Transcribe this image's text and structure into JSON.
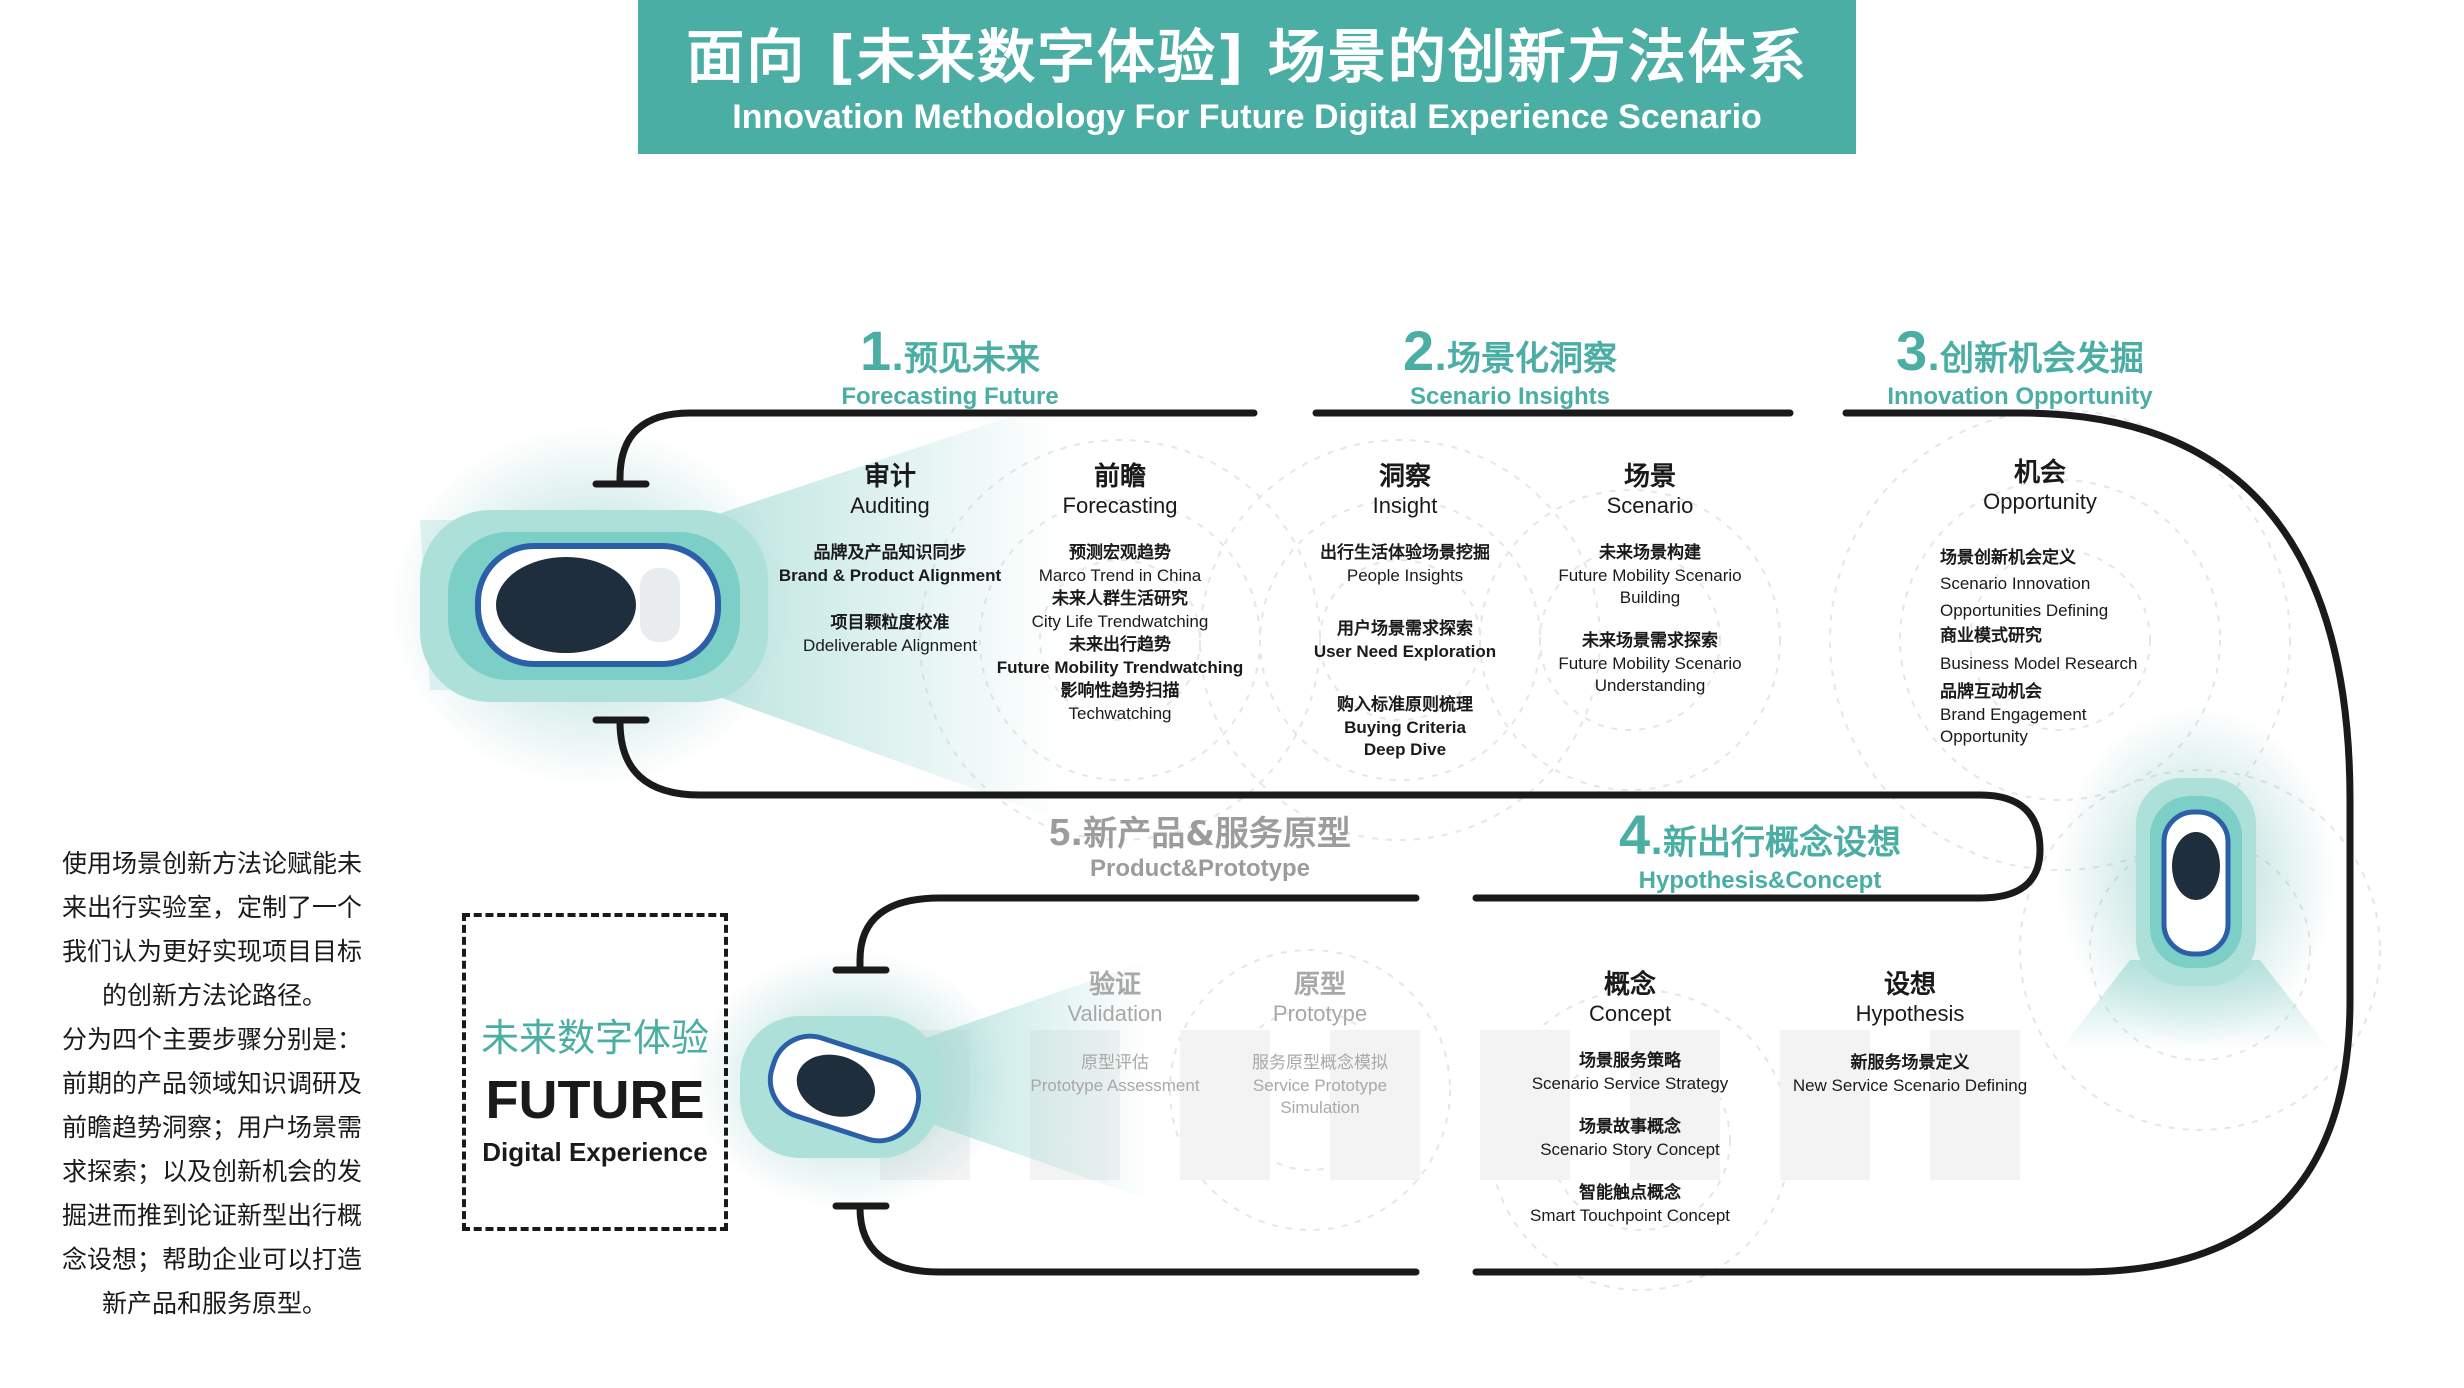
{
  "header": {
    "title_cn": "面向 [未来数字体验] 场景的创新方法体系",
    "title_en": "Innovation Methodology For Future Digital Experience Scenario"
  },
  "colors": {
    "accent": "#4aaea4",
    "track": "#1a1a1a",
    "muted": "#a8a8a8"
  },
  "steps": [
    {
      "num": "1",
      "cn": ".预见未来",
      "en": "Forecasting Future",
      "columns": [
        {
          "cn": "审计",
          "en": "Auditing",
          "items": [
            {
              "cn": "品牌及产品知识同步",
              "en": "Brand & Product Alignment"
            },
            {
              "cn": "项目颗粒度校准",
              "en": "Ddeliverable Alignment"
            }
          ]
        },
        {
          "cn": "前瞻",
          "en": "Forecasting",
          "items": [
            {
              "cn": "预测宏观趋势",
              "en": "Marco Trend in China"
            },
            {
              "cn": "未来人群生活研究",
              "en": "City Life Trendwatching"
            },
            {
              "cn": "未来出行趋势",
              "en": "Future Mobility Trendwatching"
            },
            {
              "cn": "影响性趋势扫描",
              "en": "Techwatching"
            }
          ]
        }
      ]
    },
    {
      "num": "2",
      "cn": ".场景化洞察",
      "en": "Scenario Insights",
      "columns": [
        {
          "cn": "洞察",
          "en": "Insight",
          "items": [
            {
              "cn": "出行生活体验场景挖掘",
              "en": "People Insights"
            },
            {
              "cn": "用户场景需求探索",
              "en": "User Need Exploration"
            },
            {
              "cn": "购入标准原则梳理",
              "en": "Buying Criteria Deep Dive"
            }
          ]
        },
        {
          "cn": "场景",
          "en": "Scenario",
          "items": [
            {
              "cn": "未来场景构建",
              "en": "Future Mobility Scenario Building"
            },
            {
              "cn": "未来场景需求探索",
              "en": "Future  Mobility Scenario Understanding"
            }
          ]
        }
      ]
    },
    {
      "num": "3",
      "cn": ".创新机会发掘",
      "en": "Innovation Opportunity",
      "columns": [
        {
          "cn": "机会",
          "en": "Opportunity",
          "items": [
            {
              "cn": "场景创新机会定义",
              "en": "Scenario Innovation Opportunities Defining"
            },
            {
              "cn": "商业模式研究",
              "en": "Business Model Research"
            },
            {
              "cn": "品牌互动机会",
              "en": "Brand Engagement Opportunity"
            }
          ]
        }
      ]
    },
    {
      "num": "4",
      "cn": ".新出行概念设想",
      "en": "Hypothesis&Concept",
      "columns": [
        {
          "cn": "概念",
          "en": "Concept",
          "items": [
            {
              "cn": "场景服务策略",
              "en": "Scenario Service Strategy"
            },
            {
              "cn": "场景故事概念",
              "en": "Scenario Story Concept"
            },
            {
              "cn": "智能触点概念",
              "en": "Smart Touchpoint Concept"
            }
          ]
        },
        {
          "cn": "设想",
          "en": "Hypothesis",
          "items": [
            {
              "cn": "新服务场景定义",
              "en": "New Service Scenario Defining"
            }
          ]
        }
      ]
    },
    {
      "num": "5",
      "cn": ".新产品&服务原型",
      "en": "Product&Prototype",
      "columns": [
        {
          "cn": "验证",
          "en": "Validation",
          "items": [
            {
              "cn": "原型评估",
              "en": "Prototype Assessment"
            }
          ]
        },
        {
          "cn": "原型",
          "en": "Prototype",
          "items": [
            {
              "cn": "服务原型概念模拟",
              "en": "Service Prototype Simulation"
            }
          ]
        }
      ]
    }
  ],
  "side_text": [
    "使用场景创新方法论赋能未",
    "来出行实验室，定制了一个",
    "我们认为更好实现项目目标",
    "的创新方法论路径。",
    "分为四个主要步骤分别是：",
    "前期的产品领域知识调研及",
    "前瞻趋势洞察；用户场景需",
    "求探索；以及创新机会的发",
    "掘进而推到论证新型出行概",
    "念设想；帮助企业可以打造",
    "新产品和服务原型。"
  ],
  "future_box": {
    "cn": "未来数字体验",
    "big": "FUTURE",
    "sub": "Digital Experience"
  }
}
